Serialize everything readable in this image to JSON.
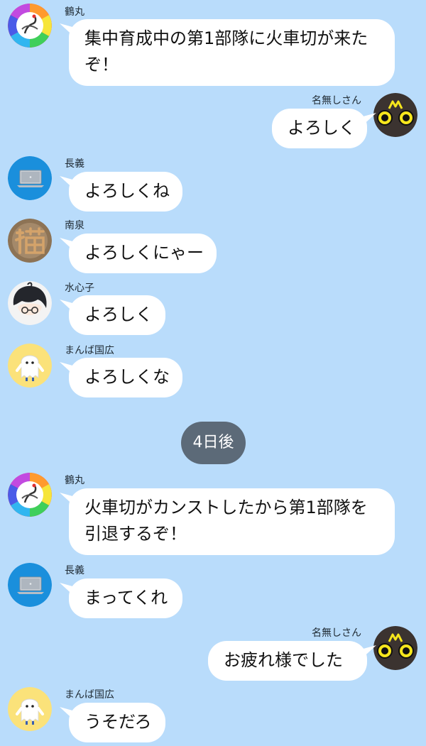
{
  "colors": {
    "background": "#b9dcfb",
    "bubble": "#ffffff",
    "date_pill": "#5c6a78"
  },
  "separator": {
    "label": "4日後"
  },
  "messages": [
    {
      "sender": "鶴丸",
      "side": "left",
      "avatar_icon": "crane-rainbow-icon",
      "lines": [
        "集中育成中の第1部隊に火車切が来た",
        "ぞ！"
      ]
    },
    {
      "sender": "名無しさん",
      "side": "right",
      "avatar_icon": "yellow-eyes-face-icon",
      "lines": [
        "よろしく"
      ]
    },
    {
      "sender": "長義",
      "side": "left",
      "avatar_icon": "laptop-icon",
      "lines": [
        "よろしくね"
      ]
    },
    {
      "sender": "南泉",
      "side": "left",
      "avatar_icon": "cat-kanji-icon",
      "lines": [
        "よろしくにゃー"
      ]
    },
    {
      "sender": "水心子",
      "side": "left",
      "avatar_icon": "anime-boy-icon",
      "lines": [
        "よろしく"
      ]
    },
    {
      "sender": "まんば国広",
      "side": "left",
      "avatar_icon": "ghost-icon",
      "lines": [
        "よろしくな"
      ]
    },
    {
      "sender": "鶴丸",
      "side": "left",
      "avatar_icon": "crane-rainbow-icon",
      "lines": [
        "火車切がカンストしたから第1部隊を",
        "引退するぞ！"
      ]
    },
    {
      "sender": "長義",
      "side": "left",
      "avatar_icon": "laptop-icon",
      "lines": [
        "まってくれ"
      ]
    },
    {
      "sender": "名無しさん",
      "side": "right",
      "avatar_icon": "yellow-eyes-face-icon",
      "lines": [
        "お疲れ様でした"
      ]
    },
    {
      "sender": "まんば国広",
      "side": "left",
      "avatar_icon": "ghost-icon",
      "lines": [
        "うそだろ"
      ]
    }
  ]
}
